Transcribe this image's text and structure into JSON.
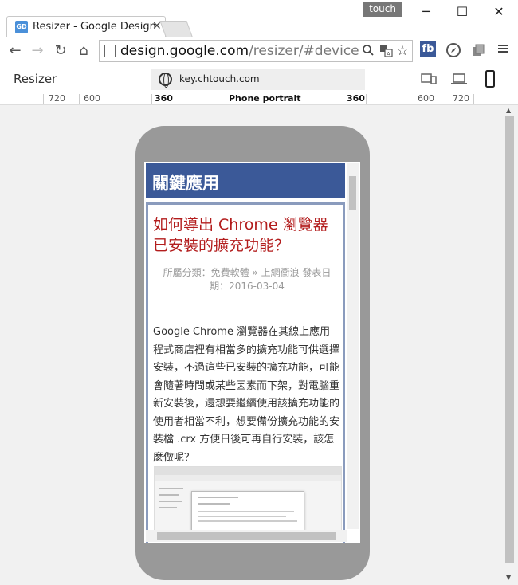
{
  "browser": {
    "tab_title": "Resizer - Google Design",
    "favicon_text": "GD",
    "touch_badge": "touch",
    "url_host": "design.google.com",
    "url_path": "/resizer/#device=har"
  },
  "resizer": {
    "title": "Resizer",
    "url_field": "key.chtouch.com"
  },
  "ruler": {
    "left_720": "720",
    "left_600": "600",
    "left_360": "360",
    "center_label": "Phone portrait",
    "right_360": "360",
    "right_600": "600",
    "right_720": "720"
  },
  "site": {
    "header_title": "關鍵應用",
    "article_title": "如何導出 Chrome 瀏覽器已安裝的擴充功能？",
    "article_meta": "所屬分類：免費軟體 » 上網衝浪 發表日期：2016-03-04",
    "article_body": "Google Chrome 瀏覽器在其線上應用程式商店裡有相當多的擴充功能可供選擇安裝，不過這些已安裝的擴充功能，可能會隨著時間或某些因素而下架，對電腦重新安裝後，還想要繼續使用該擴充功能的使用者相當不利，想要備份擴充功能的安裝檔 .crx 方便日後可再自行安裝，該怎麼做呢？"
  },
  "colors": {
    "site_header_bg": "#3b5998",
    "article_title": "#b31d1d",
    "device_frame": "#999999"
  }
}
